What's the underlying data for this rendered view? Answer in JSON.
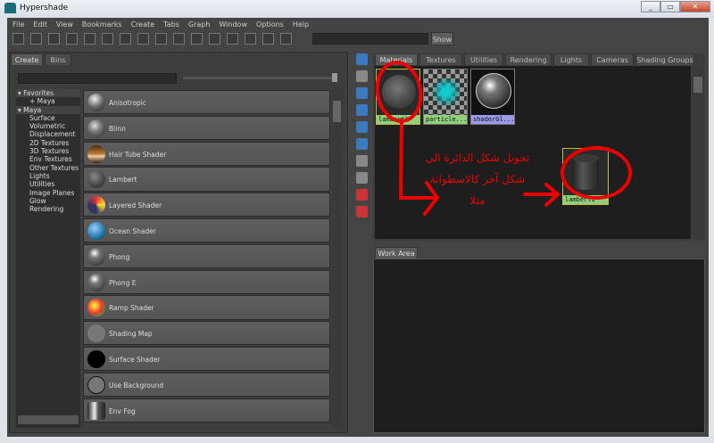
{
  "window": {
    "title": "Hypershade",
    "controls": [
      "_",
      "▭",
      "✕"
    ]
  },
  "menu": [
    "File",
    "Edit",
    "View",
    "Bookmarks",
    "Create",
    "Tabs",
    "Graph",
    "Window",
    "Options",
    "Help"
  ],
  "toolbar": {
    "show_label": "Show",
    "field_value": ""
  },
  "left": {
    "tabs": [
      "Create",
      "Bins"
    ],
    "tree": [
      {
        "label": "Favorites",
        "type": "hdr"
      },
      {
        "label": "+ Maya",
        "type": "sub0"
      },
      {
        "label": "Maya",
        "type": "hdr"
      },
      {
        "label": "Surface"
      },
      {
        "label": "Volumetric"
      },
      {
        "label": "Displacement"
      },
      {
        "label": "2D Textures"
      },
      {
        "label": "3D Textures"
      },
      {
        "label": "Env Textures"
      },
      {
        "label": "Other Textures"
      },
      {
        "label": "Lights"
      },
      {
        "label": "Utilities"
      },
      {
        "label": "Image Planes"
      },
      {
        "label": "Glow"
      },
      {
        "label": "Rendering"
      }
    ],
    "shaders": [
      {
        "label": "Anisotropic",
        "swatch": "radial-gradient(circle at 40% 30%,#eee,#666 50%,#222)"
      },
      {
        "label": "Blinn",
        "swatch": "radial-gradient(circle at 40% 35%,#ddd,#777 40%,#222)"
      },
      {
        "label": "Hair Tube Shader",
        "swatch": "linear-gradient(#4a2a10,#c08040 50%,#f0d0a0 60%,#3a2010)"
      },
      {
        "label": "Lambert",
        "swatch": "radial-gradient(circle at 40% 35%,#888,#444 60%,#222)"
      },
      {
        "label": "Layered Shader",
        "swatch": "conic-gradient(#e33,#fd3,#336,#336,#e33)"
      },
      {
        "label": "Ocean Shader",
        "swatch": "radial-gradient(circle at 40% 35%,#9cf,#27a 60%,#035)"
      },
      {
        "label": "Phong",
        "swatch": "radial-gradient(circle at 40% 30%,#fff,#777 30%,#222)"
      },
      {
        "label": "Phong E",
        "swatch": "radial-gradient(circle at 40% 30%,#fff,#777 30%,#222)"
      },
      {
        "label": "Ramp Shader",
        "swatch": "radial-gradient(circle at 40% 40%,#ff3,#e33 50%,#3a3 80%)"
      },
      {
        "label": "Shading Map",
        "swatch": "#777"
      },
      {
        "label": "Surface Shader",
        "swatch": "#000"
      },
      {
        "label": "Use Background",
        "swatch": "#777"
      },
      {
        "label": "Env Fog",
        "swatch": "linear-gradient(90deg,#222,#eee 40%,#555 60%,#222)"
      }
    ]
  },
  "top": {
    "tabs": [
      "Materials",
      "Textures",
      "Utilities",
      "Rendering",
      "Lights",
      "Cameras",
      "Shading Groups"
    ],
    "nodes": [
      {
        "label": "lambert1",
        "color": "#8fd07a"
      },
      {
        "label": "particle...",
        "color": "#8fd07a"
      },
      {
        "label": "shaderGl...",
        "color": "#9a98e8"
      }
    ],
    "cylinder_node": {
      "label": "lambert1",
      "color": "#8fd07a"
    }
  },
  "work": {
    "tab": "Work Area"
  },
  "annotation": {
    "text_line1": "تحويل شكل الدائرة الى",
    "text_line2": "شكل آخر كالاسطوانة",
    "text_line3": "مثلا",
    "color": "#e00000"
  }
}
